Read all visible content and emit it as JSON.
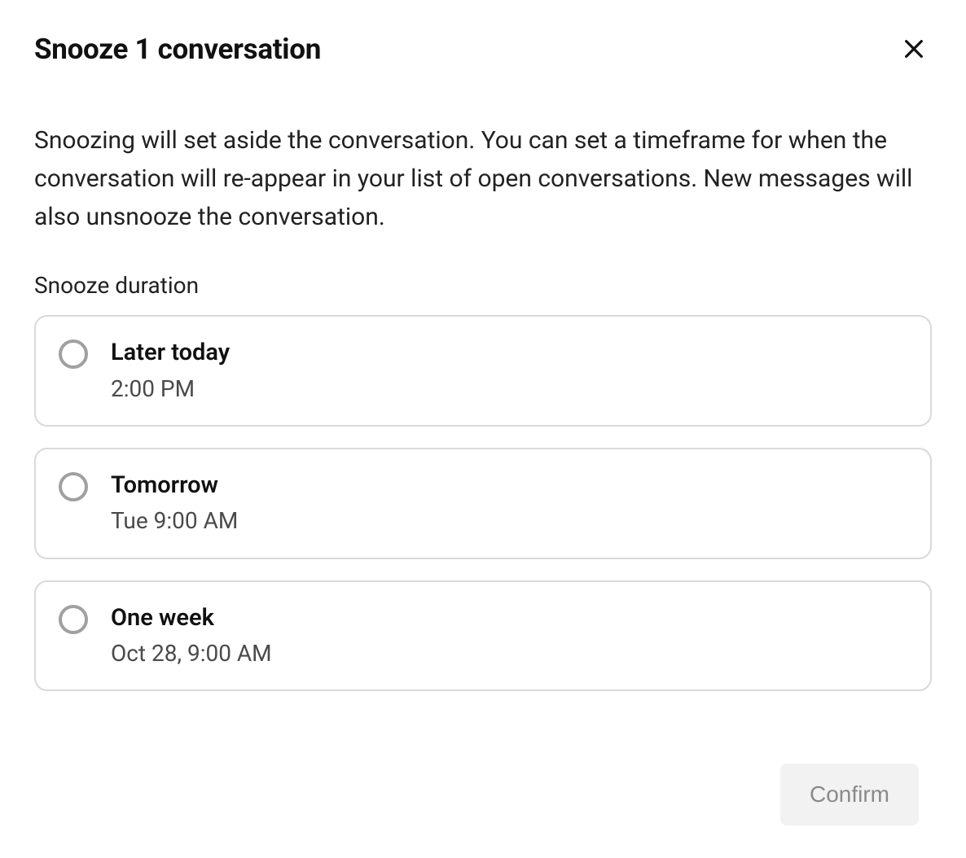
{
  "dialog": {
    "title": "Snooze 1 conversation",
    "description": "Snoozing will set aside the conversation. You can set a timeframe for when the conversation will re-appear in your list of open conversations. New messages will also unsnooze the conversation.",
    "section_label": "Snooze duration",
    "options": [
      {
        "title": "Later today",
        "subtitle": "2:00 PM"
      },
      {
        "title": "Tomorrow",
        "subtitle": "Tue 9:00 AM"
      },
      {
        "title": "One week",
        "subtitle": "Oct 28, 9:00 AM"
      }
    ],
    "confirm_label": "Confirm"
  }
}
